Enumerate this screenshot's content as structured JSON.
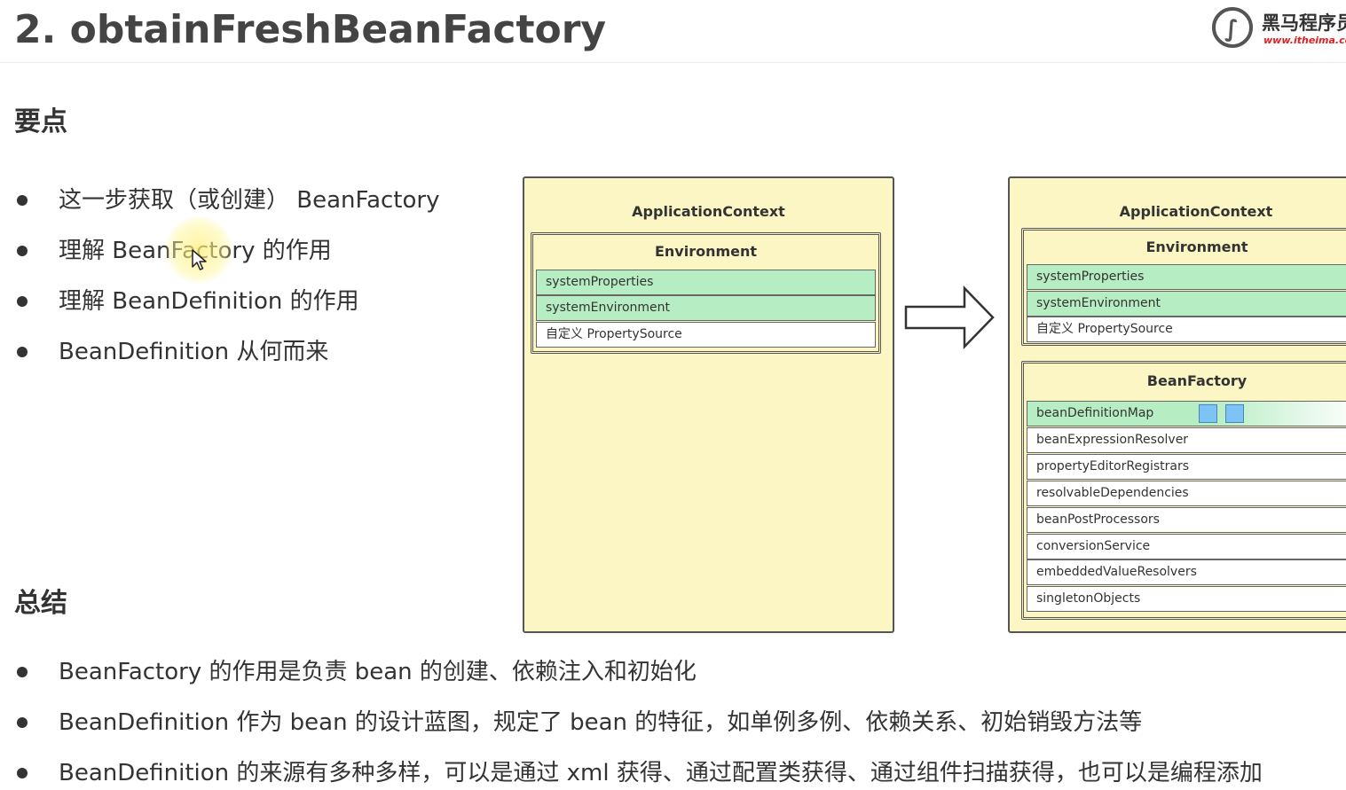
{
  "header": {
    "title": "2. obtainFreshBeanFactory",
    "logo_name": "黑马程序员",
    "logo_url": "www.itheima.com"
  },
  "key_points": {
    "heading": "要点",
    "items": [
      "这一步获取（或创建） BeanFactory",
      "理解 BeanFactory 的作用",
      "理解 BeanDefinition 的作用",
      "BeanDefinition 从何而来"
    ]
  },
  "summary": {
    "heading": "总结",
    "items": [
      "BeanFactory 的作用是负责 bean 的创建、依赖注入和初始化",
      "BeanDefinition 作为 bean 的设计蓝图，规定了 bean 的特征，如单例多例、依赖关系、初始销毁方法等",
      "BeanDefinition 的来源有多种多样，可以是通过 xml 获得、通过配置类获得、通过组件扫描获得，也可以是编程添加"
    ]
  },
  "diagram_before": {
    "title": "ApplicationContext",
    "environment": {
      "title": "Environment",
      "rows": [
        "systemProperties",
        "systemEnvironment",
        "自定义 PropertySource"
      ]
    }
  },
  "diagram_after": {
    "title": "ApplicationContext",
    "environment": {
      "title": "Environment",
      "rows": [
        "systemProperties",
        "systemEnvironment",
        "自定义 PropertySource"
      ]
    },
    "bean_factory": {
      "title": "BeanFactory",
      "rows": [
        "beanDefinitionMap",
        "beanExpressionResolver",
        "propertyEditorRegistrars",
        "resolvableDependencies",
        "beanPostProcessors",
        "conversionService",
        "embeddedValueResolvers",
        "singletonObjects"
      ]
    }
  },
  "colors": {
    "diagram_fill": "#fbf6c4",
    "highlight_row": "#b7edc3",
    "map_square": "#7ec3f5",
    "logo_url": "#e02020"
  },
  "icons": [
    "logo-icon",
    "right-arrow-icon",
    "mouse-cursor-icon"
  ]
}
